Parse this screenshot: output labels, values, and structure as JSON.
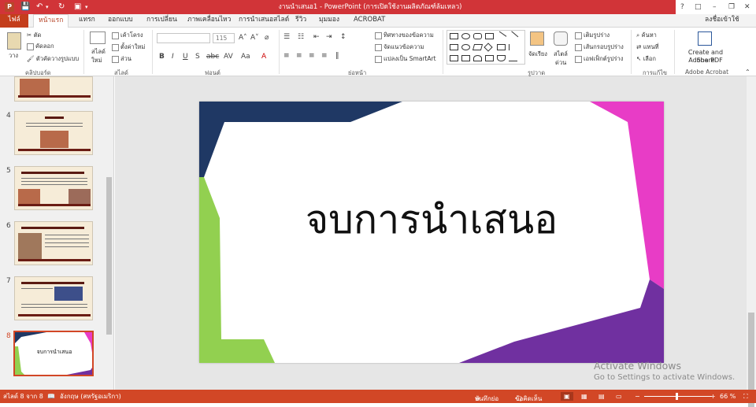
{
  "window": {
    "title": "งานนำเสนอ1 -  PowerPoint (การเปิดใช้งานผลิตภัณฑ์ล้มเหลว)",
    "app_icon": "P",
    "sign_in": "ลงชื่อเข้าใช้",
    "accent": "#d24726"
  },
  "tabs": [
    "ไฟล์",
    "หน้าแรก",
    "แทรก",
    "ออกแบบ",
    "การเปลี่ยน",
    "ภาพเคลื่อนไหว",
    "การนำเสนอสไลด์",
    "รีวิว",
    "มุมมอง",
    "ACROBAT"
  ],
  "ribbon": {
    "clipboard": {
      "paste": "วาง",
      "cut": "ตัด",
      "copy": "คัดลอก",
      "format_painter": "ตัวคัดวางรูปแบบ",
      "label": "คลิปบอร์ด"
    },
    "slides": {
      "new_slide_line1": "สไลด์",
      "new_slide_line2": "ใหม่",
      "layout": "เค้าโครง",
      "reset": "ตั้งค่าใหม่",
      "section": "ส่วน",
      "label": "สไลด์"
    },
    "font": {
      "size": "115",
      "label": "ฟอนต์"
    },
    "paragraph": {
      "text_direction": "ทิศทางของข้อความ",
      "align_text": "จัดแนวข้อความ",
      "smartart": "แปลงเป็น SmartArt",
      "label": "ย่อหน้า"
    },
    "drawing": {
      "arrange": "จัดเรียง",
      "quick_styles_line1": "สไตล์",
      "quick_styles_line2": "ด่วน",
      "shape_fill": "เติมรูปร่าง",
      "shape_outline": "เส้นกรอบรูปร่าง",
      "shape_effects": "เอฟเฟ็กต์รูปร่าง",
      "label": "รูปวาด"
    },
    "editing": {
      "find": "ค้นหา",
      "replace": "แทนที่",
      "select": "เลือก",
      "label": "การแก้ไข"
    },
    "acrobat": {
      "create_line1": "Create and Share",
      "create_line2": "Adobe PDF",
      "label": "Adobe Acrobat"
    }
  },
  "thumbnails": [
    {
      "num": "4"
    },
    {
      "num": "5"
    },
    {
      "num": "6"
    },
    {
      "num": "7"
    },
    {
      "num": "8",
      "text": "จบการนำเสนอ",
      "selected": true
    }
  ],
  "slide": {
    "title": "จบการนำเสนอ",
    "colors": {
      "navy": "#1f3864",
      "magenta": "#e83cc6",
      "green": "#92d050",
      "purple": "#7030a0"
    }
  },
  "watermark": {
    "line1": "Activate Windows",
    "line2": "Go to Settings to activate Windows."
  },
  "status": {
    "slide_count": "สไลด์ 8 จาก 8",
    "language": "อังกฤษ (สหรัฐอเมริกา)",
    "notes": "บันทึกย่อ",
    "comments": "ข้อคิดเห็น",
    "zoom": "66 %"
  }
}
